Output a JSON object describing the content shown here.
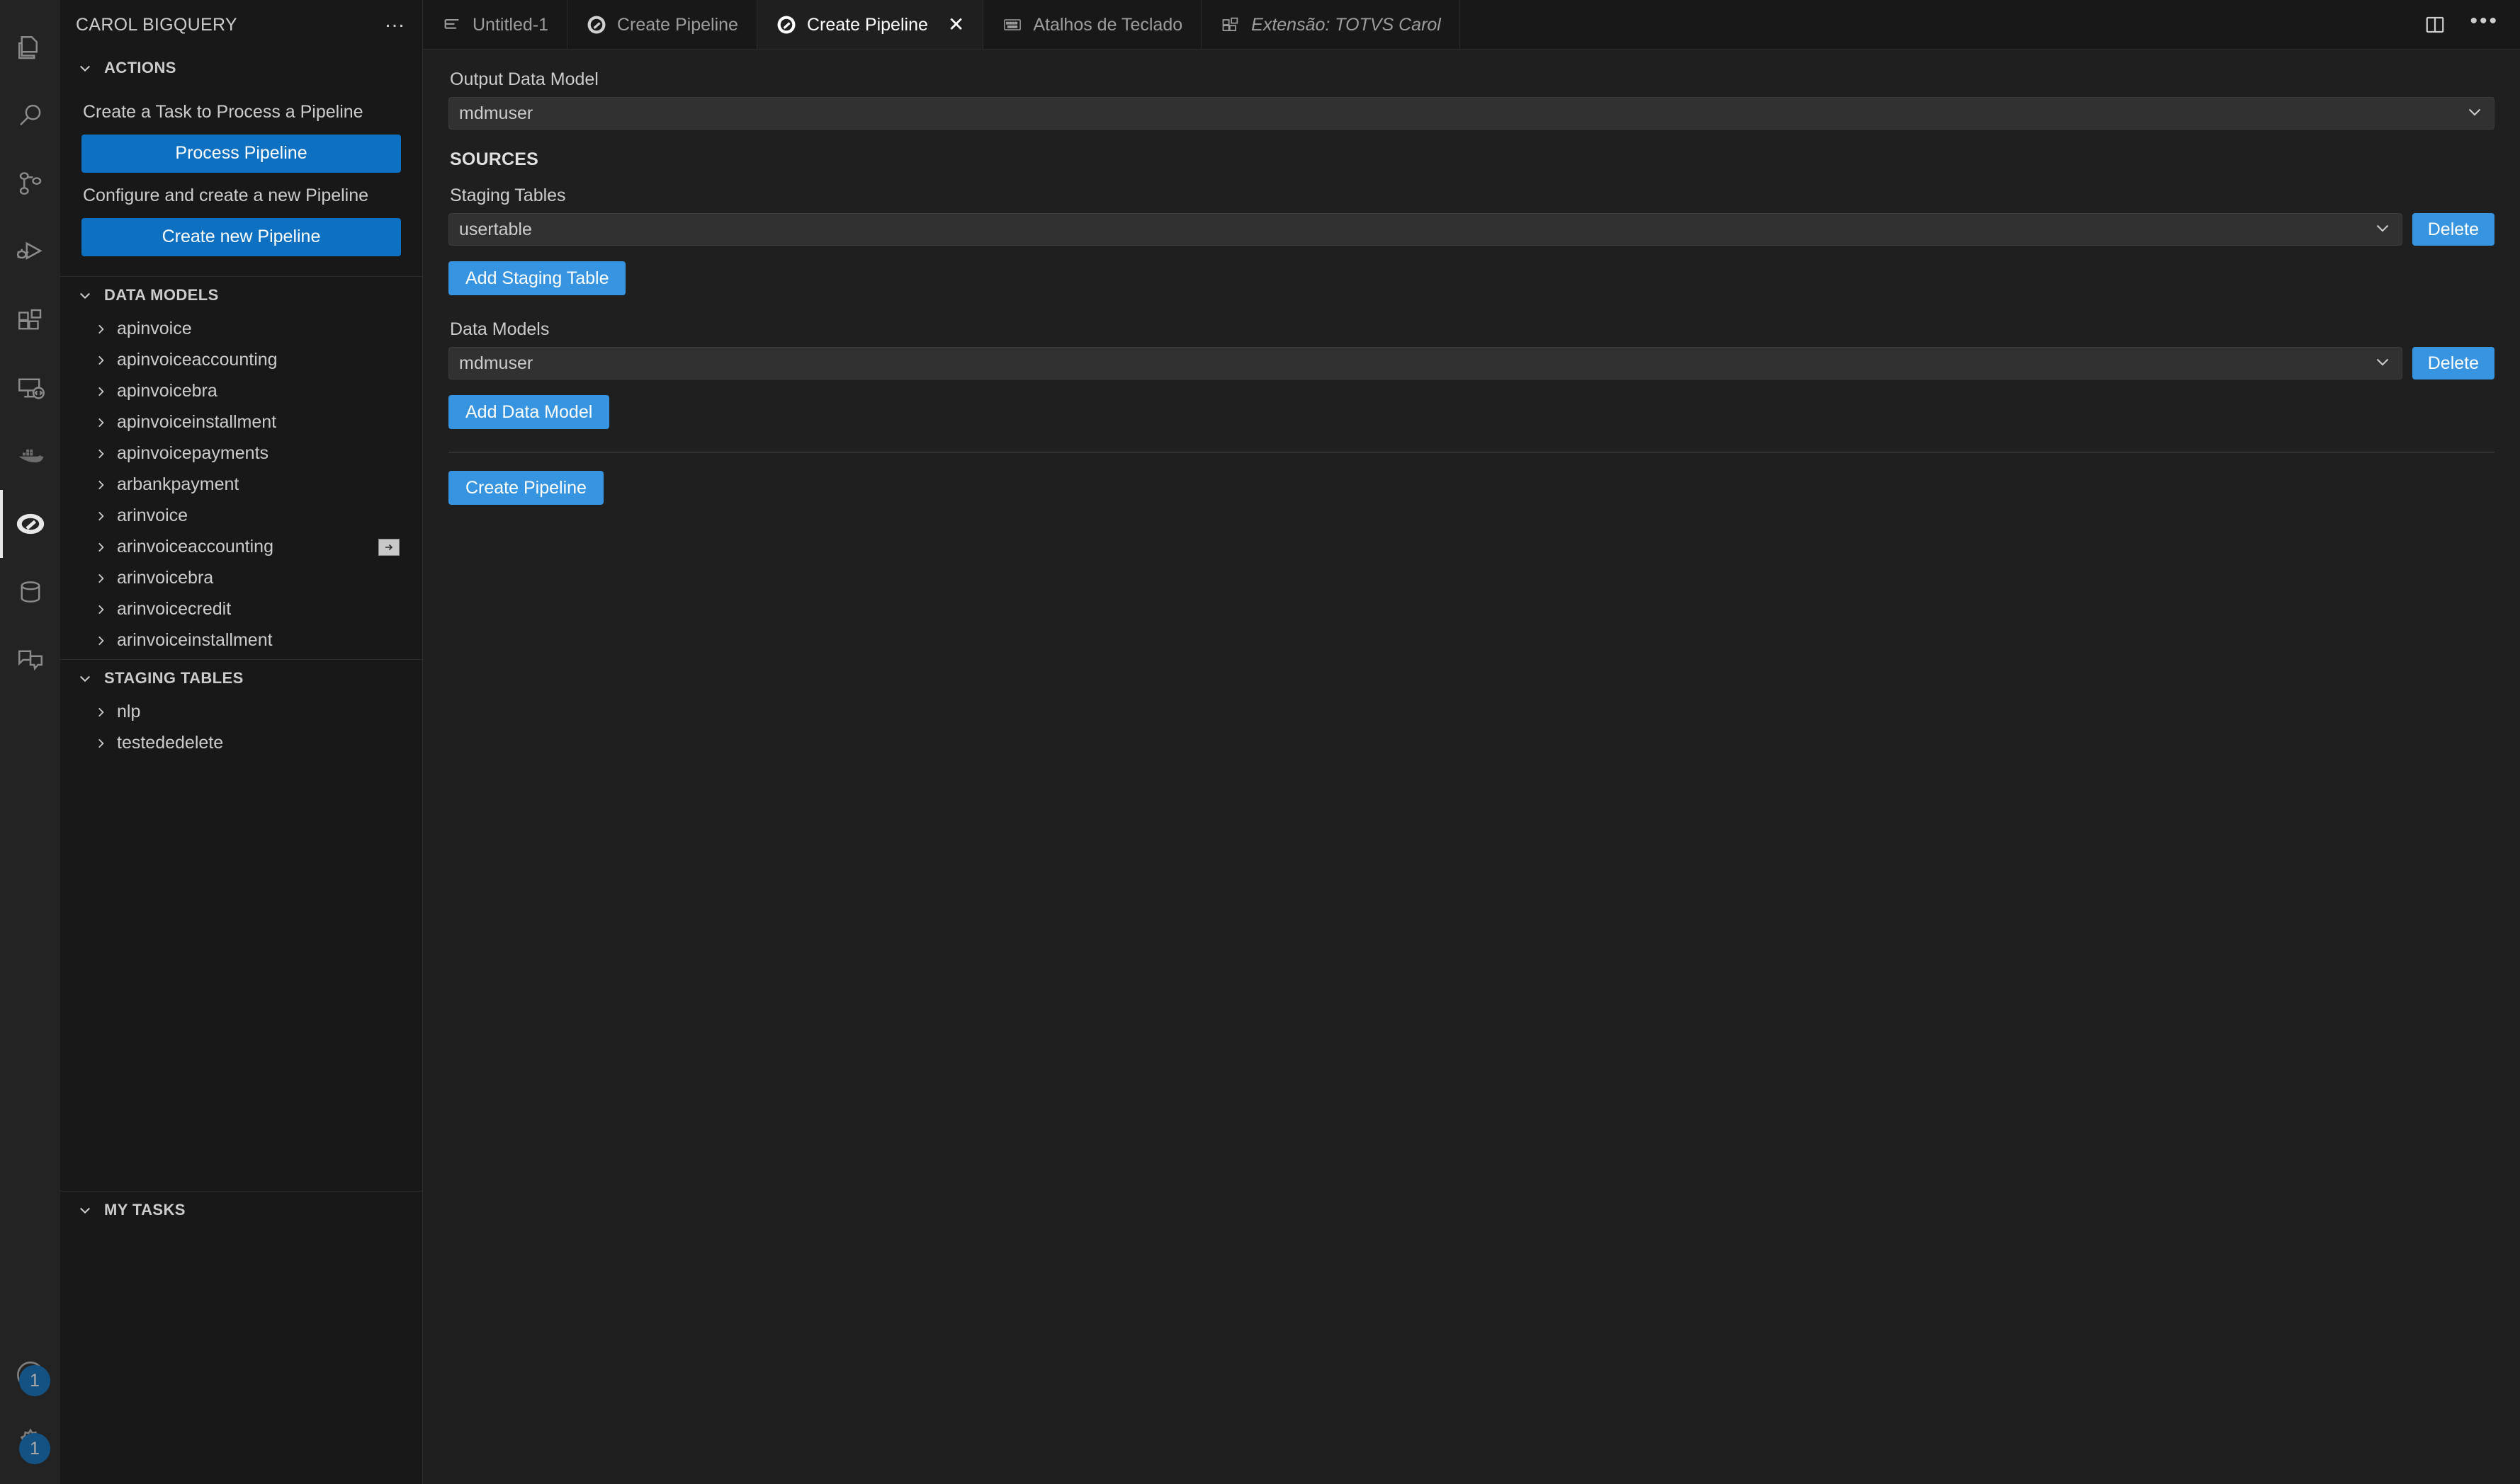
{
  "activity_bar": {
    "items": [
      {
        "name": "explorer",
        "icon": "files-icon",
        "active": false
      },
      {
        "name": "search",
        "icon": "search-icon",
        "active": false
      },
      {
        "name": "source-control",
        "icon": "source-control-icon",
        "active": false
      },
      {
        "name": "run-and-debug",
        "icon": "run-debug-icon",
        "active": false
      },
      {
        "name": "extensions",
        "icon": "extensions-icon",
        "active": false
      },
      {
        "name": "remote-explorer",
        "icon": "remote-monitor-icon",
        "active": false
      },
      {
        "name": "docker",
        "icon": "docker-whale-icon",
        "active": false
      },
      {
        "name": "carol",
        "icon": "carol-logo-icon",
        "active": true
      },
      {
        "name": "database",
        "icon": "database-cylinder-icon",
        "active": false
      },
      {
        "name": "chat",
        "icon": "chat-bubbles-icon",
        "active": false
      }
    ],
    "bottom_items": [
      {
        "name": "accounts",
        "icon": "account-icon",
        "badge": "1"
      },
      {
        "name": "manage-settings",
        "icon": "gear-icon",
        "badge": "1"
      }
    ]
  },
  "sidebar": {
    "title": "CAROL BIGQUERY",
    "more_actions": "…",
    "sections": [
      {
        "label": "ACTIONS",
        "expanded": true
      },
      {
        "label": "DATA MODELS",
        "expanded": true
      },
      {
        "label": "STAGING TABLES",
        "expanded": true
      },
      {
        "label": "MY TASKS",
        "expanded": true
      }
    ],
    "actions": {
      "process_desc": "Create a Task to Process a Pipeline",
      "process_button": "Process Pipeline",
      "create_desc": "Configure and create a new Pipeline",
      "create_button": "Create new Pipeline"
    },
    "data_models": [
      {
        "label": "apinvoice"
      },
      {
        "label": "apinvoiceaccounting"
      },
      {
        "label": "apinvoicebra"
      },
      {
        "label": "apinvoiceinstallment"
      },
      {
        "label": "apinvoicepayments"
      },
      {
        "label": "arbankpayment"
      },
      {
        "label": "arinvoice"
      },
      {
        "label": "arinvoiceaccounting",
        "action_icon": "open-to-side-icon"
      },
      {
        "label": "arinvoicebra"
      },
      {
        "label": "arinvoicecredit"
      },
      {
        "label": "arinvoiceinstallment"
      }
    ],
    "staging_tables": [
      {
        "label": "nlp"
      },
      {
        "label": "testededelete"
      }
    ],
    "my_tasks": []
  },
  "tabs": [
    {
      "label": "Untitled-1",
      "icon": "text-lines-icon",
      "active": false,
      "closable": false,
      "italic": false
    },
    {
      "label": "Create Pipeline",
      "icon": "carol-logo-icon",
      "active": false,
      "closable": false,
      "italic": false
    },
    {
      "label": "Create Pipeline",
      "icon": "carol-logo-icon",
      "active": true,
      "closable": true,
      "close_glyph": "✕",
      "italic": false
    },
    {
      "label": "Atalhos de Teclado",
      "icon": "keyboard-icon",
      "active": false,
      "closable": false,
      "italic": false
    },
    {
      "label": "Extensão: TOTVS Carol",
      "icon": "extensions-icon",
      "active": false,
      "closable": false,
      "italic": true
    }
  ],
  "editor_actions": [
    {
      "name": "split-editor",
      "icon": "split-editor-icon"
    },
    {
      "name": "more-actions",
      "icon": "ellipsis-icon",
      "glyph": "•••"
    }
  ],
  "form": {
    "output_data_model_label": "Output Data Model",
    "output_data_model_value": "mdmuser",
    "sources_title": "SOURCES",
    "staging_tables_label": "Staging Tables",
    "staging_table_value": "usertable",
    "staging_delete_label": "Delete",
    "add_staging_table_label": "Add Staging Table",
    "data_models_label": "Data Models",
    "data_model_value": "mdmuser",
    "data_model_delete_label": "Delete",
    "add_data_model_label": "Add Data Model",
    "create_pipeline_label": "Create Pipeline"
  },
  "colors": {
    "accent_blue": "#3794e0",
    "button_blue": "#0e70c0",
    "editor_bg": "#1f1f1f",
    "sidebar_bg": "#181818",
    "activitybar_bg": "#232323",
    "input_bg": "#313131",
    "text": "#cccccc"
  }
}
